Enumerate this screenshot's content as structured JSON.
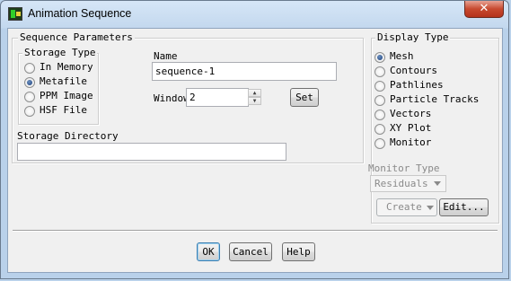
{
  "window": {
    "title": "Animation Sequence",
    "close_label": "✕"
  },
  "sequence_parameters": {
    "legend": "Sequence Parameters",
    "storage_type": {
      "legend": "Storage Type",
      "options": [
        "In Memory",
        "Metafile",
        "PPM Image",
        "HSF File"
      ],
      "selected": "Metafile"
    },
    "name_label": "Name",
    "name_value": "sequence-1",
    "window_label": "Window",
    "window_value": "2",
    "set_button": "Set",
    "storage_directory_label": "Storage Directory",
    "storage_directory_value": ""
  },
  "display_type": {
    "legend": "Display Type",
    "options": [
      "Mesh",
      "Contours",
      "Pathlines",
      "Particle Tracks",
      "Vectors",
      "XY Plot",
      "Monitor"
    ],
    "selected": "Mesh",
    "monitor_type_label": "Monitor Type",
    "monitor_type_value": "Residuals",
    "create_button": "Create",
    "edit_button": "Edit..."
  },
  "footer": {
    "ok": "OK",
    "cancel": "Cancel",
    "help": "Help"
  }
}
